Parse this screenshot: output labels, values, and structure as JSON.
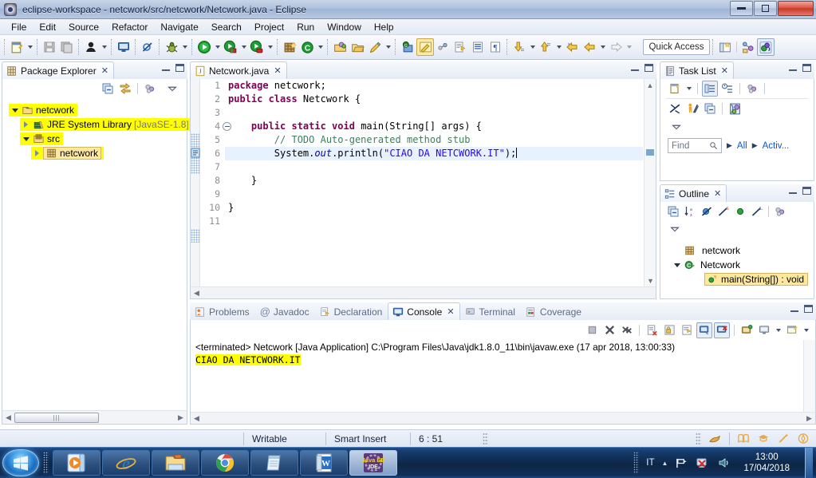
{
  "window": {
    "title": "eclipse-workspace - netcwork/src/netcwork/Netcwork.java - Eclipse",
    "app_icon": "eclipse-icon",
    "minimize_label": "Minimize",
    "maximize_label": "Maximize",
    "close_label": "X"
  },
  "menubar": {
    "items": [
      {
        "label": "File"
      },
      {
        "label": "Edit"
      },
      {
        "label": "Source"
      },
      {
        "label": "Refactor"
      },
      {
        "label": "Navigate"
      },
      {
        "label": "Search"
      },
      {
        "label": "Project"
      },
      {
        "label": "Run"
      },
      {
        "label": "Window"
      },
      {
        "label": "Help"
      }
    ]
  },
  "toolbar": {
    "quick_access": "Quick Access",
    "buttons": [
      {
        "name": "new-wizard",
        "icon": "new-file-icon"
      },
      {
        "name": "save",
        "icon": "save-icon"
      },
      {
        "name": "save-all",
        "icon": "save-all-icon"
      },
      {
        "name": "toggle-user",
        "icon": "user-icon"
      },
      {
        "name": "open-terminal",
        "icon": "monitor-icon"
      },
      {
        "name": "skip-breakpoints",
        "icon": "breakpoint-skip-icon"
      },
      {
        "name": "debug",
        "icon": "bug-icon"
      },
      {
        "name": "run",
        "icon": "run-green-icon"
      },
      {
        "name": "coverage",
        "icon": "coverage-icon"
      },
      {
        "name": "run-external",
        "icon": "external-tools-icon"
      },
      {
        "name": "new-java-package",
        "icon": "package-icon"
      },
      {
        "name": "new-java-class",
        "icon": "class-icon"
      },
      {
        "name": "open-type",
        "icon": "open-type-icon"
      },
      {
        "name": "open-task",
        "icon": "open-task-icon"
      },
      {
        "name": "pencil",
        "icon": "pencil-icon"
      },
      {
        "name": "search",
        "icon": "search-icon"
      },
      {
        "name": "highlight",
        "icon": "highlight-icon"
      },
      {
        "name": "link",
        "icon": "link-icon"
      },
      {
        "name": "next-annotation",
        "icon": "next-annotation-icon"
      },
      {
        "name": "prev-annotation",
        "icon": "prev-annotation-icon"
      },
      {
        "name": "paragraph",
        "icon": "paragraph-icon"
      },
      {
        "name": "next-edit",
        "icon": "down-arrow-icon"
      },
      {
        "name": "prev-edit",
        "icon": "up-arrow-icon"
      },
      {
        "name": "back",
        "icon": "back-arrow-icon"
      },
      {
        "name": "back-history",
        "icon": "back-history-icon"
      },
      {
        "name": "forward",
        "icon": "forward-arrow-icon"
      },
      {
        "name": "new-perspective",
        "icon": "new-perspective-icon"
      },
      {
        "name": "perspective-java",
        "icon": "java-perspective-icon"
      },
      {
        "name": "perspective-javaee",
        "icon": "javaee-perspective-icon"
      }
    ]
  },
  "package_explorer": {
    "title": "Package Explorer",
    "close": "✕",
    "toolbar": [
      {
        "name": "collapse-all",
        "icon": "collapse-all-icon"
      },
      {
        "name": "link-with-editor",
        "icon": "link-editor-icon"
      },
      {
        "name": "focus-active-task",
        "icon": "focus-task-icon"
      },
      {
        "name": "view-menu",
        "icon": "view-menu-icon"
      }
    ],
    "tree": [
      {
        "label": "netcwork",
        "icon": "java-project-icon",
        "indent": 0,
        "twisty": "open",
        "highlight": true
      },
      {
        "label": "JRE System Library",
        "suffix": " [JavaSE-1.8]",
        "icon": "library-icon",
        "indent": 1,
        "twisty": "closed",
        "highlight": true
      },
      {
        "label": "src",
        "icon": "source-folder-icon",
        "indent": 1,
        "twisty": "open",
        "highlight": true
      },
      {
        "label": "netcwork",
        "icon": "package-icon",
        "indent": 2,
        "twisty": "closed",
        "highlight": true,
        "selected": true
      }
    ]
  },
  "editor": {
    "tab": {
      "label": "Netcwork.java",
      "icon": "java-file-icon",
      "close": "✕"
    },
    "lines": [
      {
        "n": "1",
        "tokens": [
          {
            "t": "package ",
            "c": "kw"
          },
          {
            "t": "netcwork;",
            "c": ""
          }
        ]
      },
      {
        "n": "2",
        "tokens": [
          {
            "t": "public class ",
            "c": "kw"
          },
          {
            "t": "Netcwork {",
            "c": ""
          }
        ]
      },
      {
        "n": "3",
        "tokens": []
      },
      {
        "n": "4",
        "fold": true,
        "tokens": [
          {
            "t": "    ",
            "c": ""
          },
          {
            "t": "public static void ",
            "c": "kw"
          },
          {
            "t": "main(String[] args) {",
            "c": ""
          }
        ]
      },
      {
        "n": "5",
        "marker": "todo",
        "tokens": [
          {
            "t": "        ",
            "c": ""
          },
          {
            "t": "// TODO Auto-generated method stub",
            "c": "cmt"
          }
        ]
      },
      {
        "n": "6",
        "current": true,
        "caret": true,
        "tokens": [
          {
            "t": "        System.",
            "c": ""
          },
          {
            "t": "out",
            "c": "fld"
          },
          {
            "t": ".println(",
            "c": ""
          },
          {
            "t": "\"CIAO DA NETCWORK.IT\"",
            "c": "str"
          },
          {
            "t": ");",
            "c": ""
          }
        ]
      },
      {
        "n": "7",
        "tokens": []
      },
      {
        "n": "8",
        "tokens": [
          {
            "t": "    }",
            "c": ""
          }
        ]
      },
      {
        "n": "9",
        "tokens": []
      },
      {
        "n": "10",
        "tokens": [
          {
            "t": "}",
            "c": ""
          }
        ]
      },
      {
        "n": "11",
        "tokens": []
      }
    ]
  },
  "task_list": {
    "title": "Task List",
    "close": "✕",
    "toolbar": [
      {
        "name": "new-task",
        "icon": "new-task-icon"
      },
      {
        "name": "categorized-mode",
        "icon": "categorized-icon"
      },
      {
        "name": "scheduled-mode",
        "icon": "scheduled-icon"
      },
      {
        "name": "focus-on-workweek",
        "icon": "focus-icon"
      },
      {
        "name": "synchronize-changed",
        "icon": "synchronize-icon"
      },
      {
        "name": "collapse-all-tasks",
        "icon": "collapse-all-icon"
      },
      {
        "name": "restore-tasks",
        "icon": "restore-icon"
      },
      {
        "name": "view-menu",
        "icon": "view-menu-icon"
      }
    ],
    "find_placeholder": "Find",
    "filter_all": "All",
    "filter_activate": "Activ..."
  },
  "outline": {
    "title": "Outline",
    "close": "✕",
    "toolbar": [
      {
        "name": "collapse-all",
        "icon": "collapse-all-icon"
      },
      {
        "name": "sort",
        "icon": "sort-az-icon"
      },
      {
        "name": "hide-fields",
        "icon": "hide-fields-icon"
      },
      {
        "name": "hide-static",
        "icon": "hide-static-icon"
      },
      {
        "name": "hide-non-public",
        "icon": "hide-nonpublic-icon"
      },
      {
        "name": "hide-local-types",
        "icon": "hide-local-icon"
      },
      {
        "name": "focus-active-task",
        "icon": "focus-task-icon"
      },
      {
        "name": "view-menu",
        "icon": "view-menu-icon"
      }
    ],
    "tree": [
      {
        "label": "netcwork",
        "icon": "package-icon",
        "indent": 0,
        "twisty": "none"
      },
      {
        "label": "Netcwork",
        "icon": "class-icon",
        "indent": 0,
        "twisty": "open"
      },
      {
        "label": "main(String[]) : void",
        "icon": "method-public-static-icon",
        "indent": 1,
        "twisty": "none",
        "selected": true
      }
    ]
  },
  "console": {
    "tabs": [
      {
        "label": "Problems",
        "icon": "problems-icon",
        "active": false
      },
      {
        "label": "Javadoc",
        "icon": "javadoc-icon",
        "active": false
      },
      {
        "label": "Declaration",
        "icon": "declaration-icon",
        "active": false
      },
      {
        "label": "Console",
        "icon": "console-icon",
        "active": true,
        "close": "✕"
      },
      {
        "label": "Terminal",
        "icon": "terminal-icon",
        "active": false
      },
      {
        "label": "Coverage",
        "icon": "coverage-icon",
        "active": false
      }
    ],
    "toolbar": [
      {
        "name": "terminate",
        "icon": "terminate-icon"
      },
      {
        "name": "remove-launch",
        "icon": "remove-icon"
      },
      {
        "name": "remove-all-terminated",
        "icon": "remove-all-icon"
      },
      {
        "name": "clear-console",
        "icon": "clear-console-icon"
      },
      {
        "name": "scroll-lock",
        "icon": "scroll-lock-icon"
      },
      {
        "name": "word-wrap",
        "icon": "word-wrap-icon"
      },
      {
        "name": "show-console-on-output",
        "icon": "show-console-icon"
      },
      {
        "name": "show-console-on-error",
        "icon": "show-console-error-icon"
      },
      {
        "name": "pin-console",
        "icon": "pin-console-icon"
      },
      {
        "name": "display-selected-console",
        "icon": "display-console-icon"
      },
      {
        "name": "open-console",
        "icon": "open-console-icon"
      }
    ],
    "header": "<terminated> Netcwork [Java Application] C:\\Program Files\\Java\\jdk1.8.0_11\\bin\\javaw.exe (17 apr 2018, 13:00:33)",
    "output": "CIAO DA NETCWORK.IT"
  },
  "statusbar": {
    "writable": "Writable",
    "insert_mode": "Smart Insert",
    "position": "6 : 51",
    "right_icons": [
      {
        "name": "quick-access-status",
        "icon": "pencil-status-icon"
      },
      {
        "name": "book-icon",
        "icon": "book-icon"
      },
      {
        "name": "graduation-icon",
        "icon": "graduation-icon"
      },
      {
        "name": "wand-icon",
        "icon": "wand-icon"
      },
      {
        "name": "shield-icon",
        "icon": "shield-icon"
      }
    ]
  },
  "taskbar": {
    "start": "start-orb",
    "buttons": [
      {
        "name": "windows-media-player",
        "icon": "media-player-icon"
      },
      {
        "name": "internet-explorer",
        "icon": "ie-icon"
      },
      {
        "name": "file-explorer",
        "icon": "folder-icon"
      },
      {
        "name": "google-chrome",
        "icon": "chrome-icon"
      },
      {
        "name": "notepad",
        "icon": "notepad-icon"
      },
      {
        "name": "microsoft-word",
        "icon": "word-icon"
      },
      {
        "name": "eclipse-java-ee-ide",
        "icon": "java-ee-ide-icon",
        "active": true
      }
    ],
    "tray": {
      "language": "IT",
      "show_hidden": "▲",
      "icons": [
        {
          "name": "flag-icon"
        },
        {
          "name": "network-error-icon"
        },
        {
          "name": "volume-icon"
        }
      ],
      "time": "13:00",
      "date": "17/04/2018"
    }
  },
  "colors": {
    "highlight_yellow": "#ffff00",
    "accent_blue": "#0b3f7e",
    "keyword": "#7f0055",
    "string": "#2a00ff",
    "comment": "#3f7f5f"
  }
}
